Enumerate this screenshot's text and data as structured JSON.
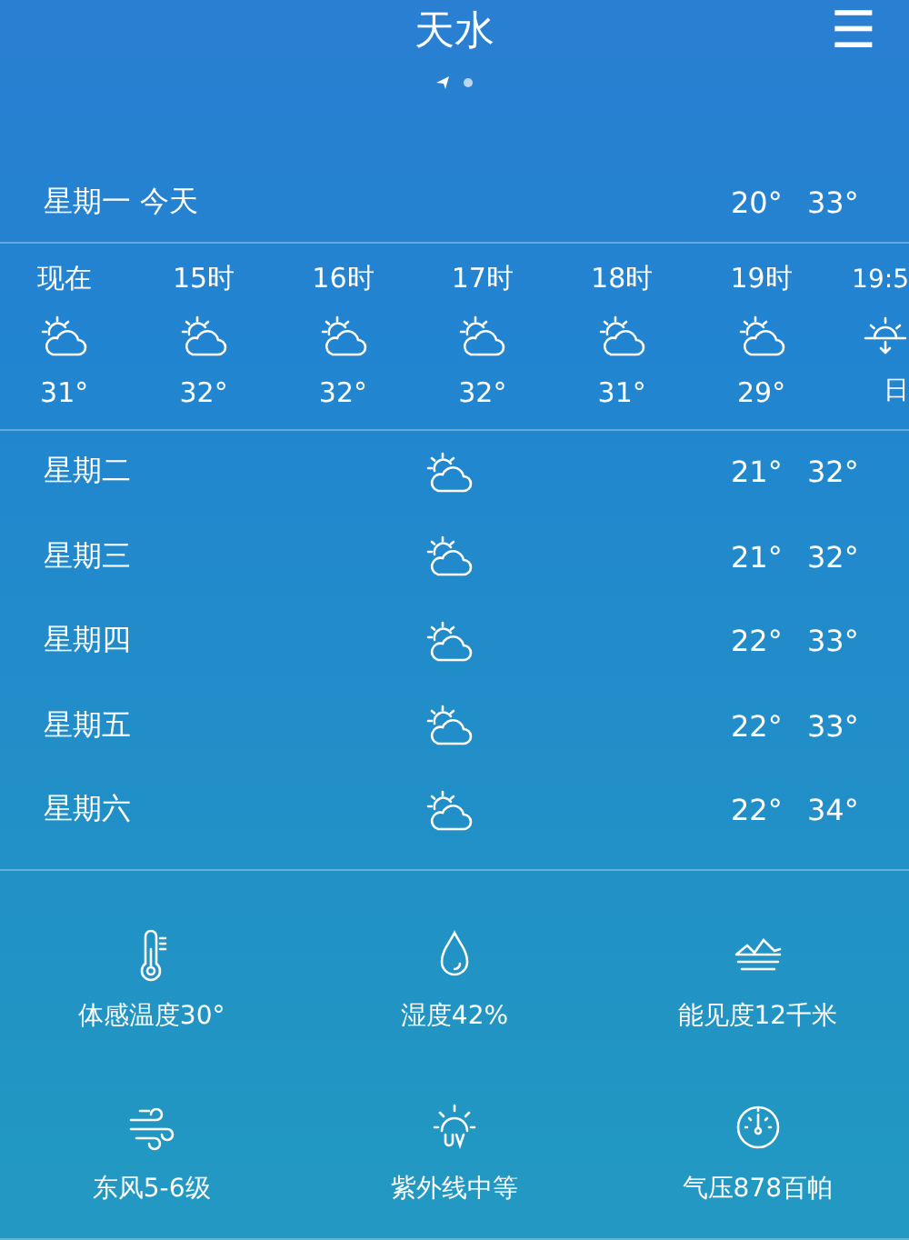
{
  "header": {
    "title": "天水",
    "menu_icon": "☰"
  },
  "today": {
    "label": "星期一  今天",
    "low": "20°",
    "high": "33°"
  },
  "hourly": [
    {
      "time": "现在",
      "kind": "partly-cloudy",
      "temp": "31°"
    },
    {
      "time": "15时",
      "kind": "partly-cloudy",
      "temp": "32°"
    },
    {
      "time": "16时",
      "kind": "partly-cloudy",
      "temp": "32°"
    },
    {
      "time": "17时",
      "kind": "partly-cloudy",
      "temp": "32°"
    },
    {
      "time": "18时",
      "kind": "partly-cloudy",
      "temp": "31°"
    },
    {
      "time": "19时",
      "kind": "partly-cloudy",
      "temp": "29°"
    },
    {
      "time": "19:5",
      "kind": "sunset",
      "temp": "日"
    }
  ],
  "daily": [
    {
      "day": "星期二",
      "kind": "partly-cloudy",
      "low": "21°",
      "high": "32°"
    },
    {
      "day": "星期三",
      "kind": "partly-cloudy",
      "low": "21°",
      "high": "32°"
    },
    {
      "day": "星期四",
      "kind": "partly-cloudy",
      "low": "22°",
      "high": "33°"
    },
    {
      "day": "星期五",
      "kind": "partly-cloudy",
      "low": "22°",
      "high": "33°"
    },
    {
      "day": "星期六",
      "kind": "partly-cloudy",
      "low": "22°",
      "high": "34°"
    }
  ],
  "details": [
    {
      "kind": "thermometer",
      "label": "体感温度30°"
    },
    {
      "kind": "humidity",
      "label": "湿度42%"
    },
    {
      "kind": "visibility",
      "label": "能见度12千米"
    },
    {
      "kind": "wind",
      "label": "东风5-6级"
    },
    {
      "kind": "uv",
      "label": "紫外线中等"
    },
    {
      "kind": "pressure",
      "label": "气压878百帕"
    }
  ]
}
